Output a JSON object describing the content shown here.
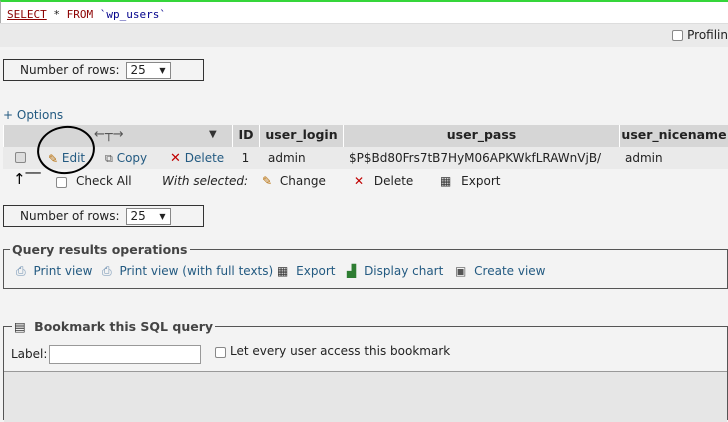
{
  "sql": {
    "select_kw": "SELECT",
    "star": " * ",
    "from_kw": "FROM",
    "table": " `wp_users`"
  },
  "profiling": {
    "label": "Profilin"
  },
  "rows_top": {
    "label": "Number of rows:",
    "value": "25"
  },
  "options_link": "+ Options",
  "table": {
    "headers": [
      "ID",
      "user_login",
      "user_pass",
      "user_nicename"
    ],
    "row": {
      "edit": "Edit",
      "copy": "Copy",
      "delete": "Delete",
      "id": "1",
      "user_login": "admin",
      "user_pass": "$P$Bd80Frs7tB7HyM06APKWkfLRAWnVjB/",
      "user_nicename": "admin"
    }
  },
  "with_selected": {
    "check_all": "Check All",
    "label": "With selected:",
    "change": "Change",
    "delete": "Delete",
    "export": "Export"
  },
  "rows_bottom": {
    "label": "Number of rows:",
    "value": "25"
  },
  "query_ops": {
    "legend": "Query results operations",
    "print_view": "Print view",
    "print_view_full": "Print view (with full texts)",
    "export": "Export",
    "display_chart": "Display chart",
    "create_view": "Create view"
  },
  "bookmark": {
    "legend": "Bookmark this SQL query",
    "label": "Label:",
    "let_every": "Let every user access this bookmark"
  },
  "colors": {
    "link": "#235a81",
    "header_bg": "#d6d6d6",
    "row_bg": "#eaeaea",
    "delete_red": "#c00000"
  }
}
